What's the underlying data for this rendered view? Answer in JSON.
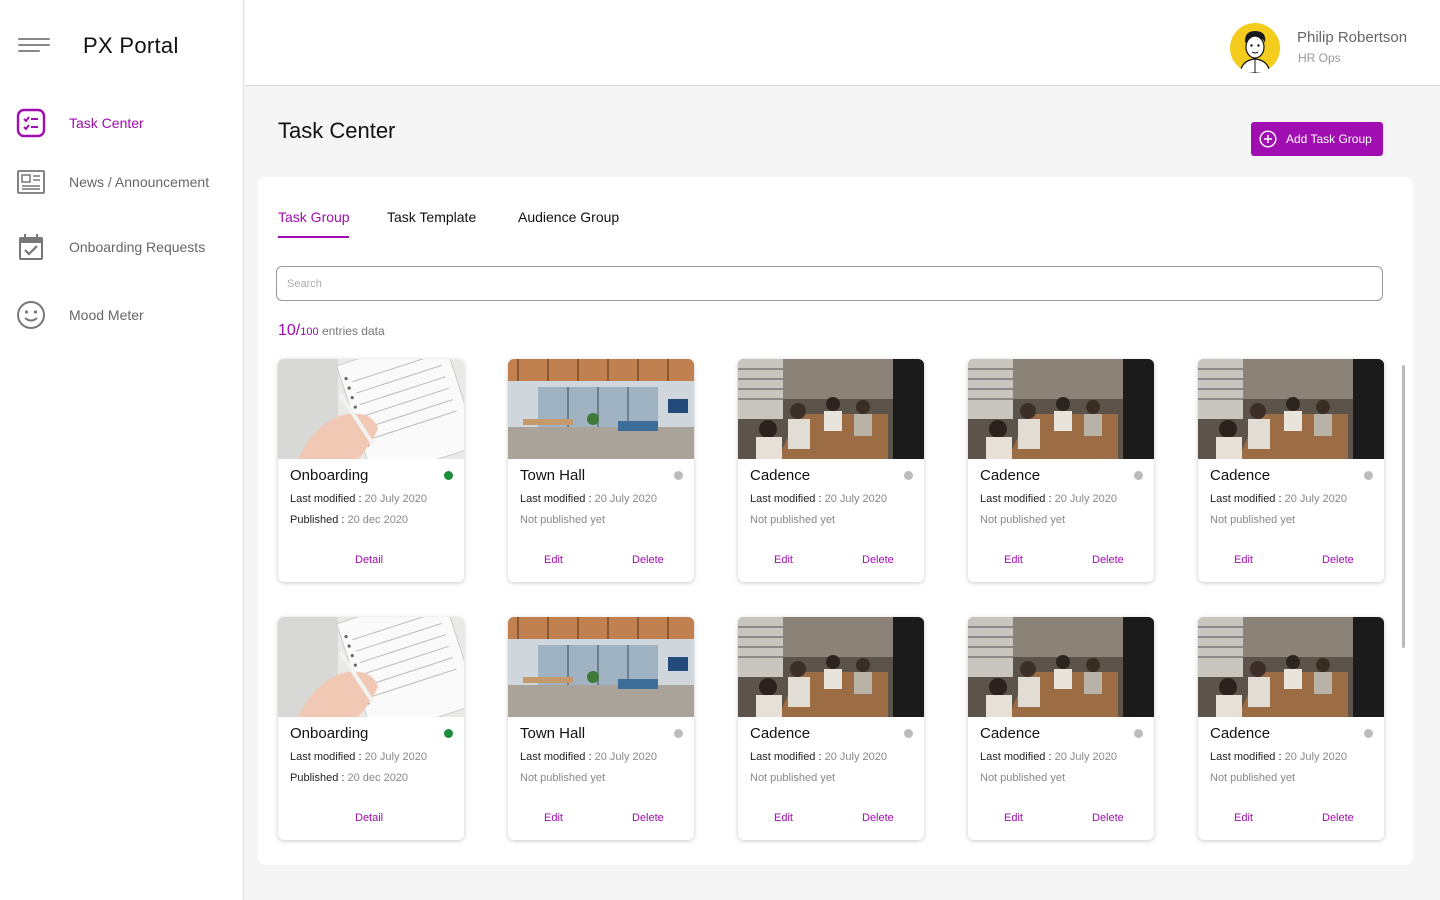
{
  "app": {
    "title": "PX Portal"
  },
  "colors": {
    "accent": "#a00db0",
    "published": "#1a8c3a",
    "unpublished": "#bcbcbc"
  },
  "sidebar": {
    "items": [
      {
        "label": "Task Center",
        "icon": "task-list-icon",
        "active": true
      },
      {
        "label": "News /  Announcement",
        "icon": "newspaper-icon",
        "active": false
      },
      {
        "label": "Onboarding Requests",
        "icon": "calendar-check-icon",
        "active": false
      },
      {
        "label": "Mood Meter",
        "icon": "smiley-icon",
        "active": false
      }
    ]
  },
  "header": {
    "user_name": "Philip Robertson",
    "user_role": "HR Ops"
  },
  "main": {
    "page_title": "Task Center",
    "add_button": "Add Task Group",
    "tabs": [
      {
        "label": "Task Group",
        "active": true
      },
      {
        "label": "Task Template",
        "active": false
      },
      {
        "label": "Audience Group",
        "active": false
      }
    ],
    "search": {
      "placeholder": "Search",
      "value": ""
    },
    "entries": {
      "shown": "10/",
      "total": "100",
      "suffix": " entries data"
    },
    "cards": [
      {
        "title": "Onboarding",
        "status": "published",
        "modified_label": "Last modified :",
        "modified": " 20 July 2020",
        "published_label": "Published :",
        "published": " 20 dec 2020",
        "actions": [
          "Detail"
        ],
        "image": "notebook-photo"
      },
      {
        "title": "Town Hall",
        "status": "unpublished",
        "modified_label": "Last modified :",
        "modified": " 20 July 2020",
        "published_label": "",
        "published": "Not published yet",
        "actions": [
          "Edit",
          "Delete"
        ],
        "image": "office-photo"
      },
      {
        "title": "Cadence",
        "status": "unpublished",
        "modified_label": "Last modified :",
        "modified": " 20 July 2020",
        "published_label": "",
        "published": "Not published yet",
        "actions": [
          "Edit",
          "Delete"
        ],
        "image": "meeting-photo"
      },
      {
        "title": "Cadence",
        "status": "unpublished",
        "modified_label": "Last modified :",
        "modified": " 20 July 2020",
        "published_label": "",
        "published": "Not published yet",
        "actions": [
          "Edit",
          "Delete"
        ],
        "image": "meeting-photo"
      },
      {
        "title": "Cadence",
        "status": "unpublished",
        "modified_label": "Last modified :",
        "modified": " 20 July 2020",
        "published_label": "",
        "published": "Not published yet",
        "actions": [
          "Edit",
          "Delete"
        ],
        "image": "meeting-photo"
      },
      {
        "title": "Onboarding",
        "status": "published",
        "modified_label": "Last modified :",
        "modified": " 20 July 2020",
        "published_label": "Published :",
        "published": " 20 dec 2020",
        "actions": [
          "Detail"
        ],
        "image": "notebook-photo"
      },
      {
        "title": "Town Hall",
        "status": "unpublished",
        "modified_label": "Last modified :",
        "modified": " 20 July 2020",
        "published_label": "",
        "published": "Not published yet",
        "actions": [
          "Edit",
          "Delete"
        ],
        "image": "office-photo"
      },
      {
        "title": "Cadence",
        "status": "unpublished",
        "modified_label": "Last modified :",
        "modified": " 20 July 2020",
        "published_label": "",
        "published": "Not published yet",
        "actions": [
          "Edit",
          "Delete"
        ],
        "image": "meeting-photo"
      },
      {
        "title": "Cadence",
        "status": "unpublished",
        "modified_label": "Last modified :",
        "modified": " 20 July 2020",
        "published_label": "",
        "published": "Not published yet",
        "actions": [
          "Edit",
          "Delete"
        ],
        "image": "meeting-photo"
      },
      {
        "title": "Cadence",
        "status": "unpublished",
        "modified_label": "Last modified :",
        "modified": " 20 July 2020",
        "published_label": "",
        "published": "Not published yet",
        "actions": [
          "Edit",
          "Delete"
        ],
        "image": "meeting-photo"
      }
    ]
  }
}
